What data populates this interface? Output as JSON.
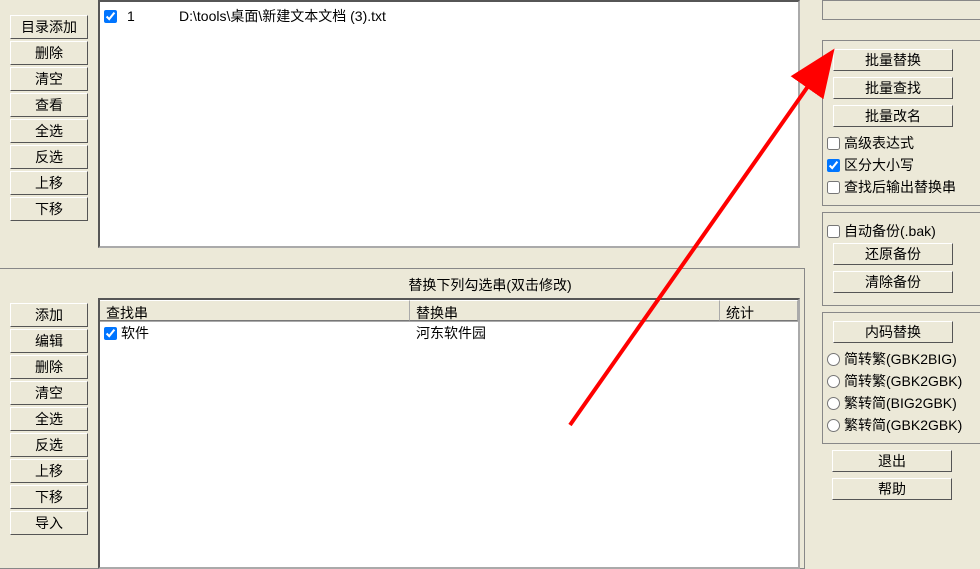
{
  "leftTop": {
    "addDir": "目录添加",
    "delete": "删除",
    "clear": "清空",
    "view": "查看",
    "selectAll": "全选",
    "invert": "反选",
    "moveUp": "上移",
    "moveDown": "下移"
  },
  "leftBottom": {
    "add": "添加",
    "edit": "编辑",
    "delete": "删除",
    "clear": "清空",
    "selectAll": "全选",
    "invert": "反选",
    "moveUp": "上移",
    "moveDown": "下移",
    "import": "导入"
  },
  "fileList": {
    "items": [
      {
        "num": "1",
        "path": "D:\\tools\\桌面\\新建文本文档 (3).txt",
        "checked": true
      }
    ]
  },
  "midSection": {
    "title": "替换下列勾选串(双击修改)",
    "headers": {
      "search": "查找串",
      "replace": "替换串",
      "count": "统计"
    },
    "rows": [
      {
        "checked": true,
        "search": "软件",
        "replace": "河东软件园",
        "count": ""
      }
    ]
  },
  "right": {
    "batchReplace": "批量替换",
    "batchFind": "批量查找",
    "batchRename": "批量改名",
    "advExpr": "高级表达式",
    "caseSensitive": "区分大小写",
    "outputAfterFind": "查找后输出替换串",
    "autoBackup": "自动备份(.bak)",
    "restoreBackup": "还原备份",
    "clearBackup": "清除备份",
    "encodingReplace": "内码替换",
    "enc1": "简转繁(GBK2BIG)",
    "enc2": "简转繁(GBK2GBK)",
    "enc3": "繁转简(BIG2GBK)",
    "enc4": "繁转简(GBK2GBK)",
    "exit": "退出",
    "help": "帮助"
  }
}
